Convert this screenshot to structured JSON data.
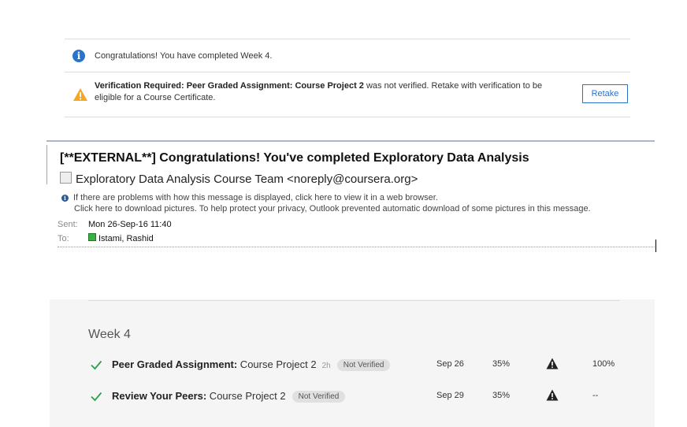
{
  "notices": {
    "completed": "Congratulations! You have completed Week 4.",
    "verification_bold": "Verification Required: Peer Graded Assignment: Course Project 2",
    "verification_rest": " was not verified. Retake with verification to be eligible for a Course Certificate.",
    "retake_label": "Retake"
  },
  "email": {
    "subject": "[**EXTERNAL**] Congratulations! You've completed Exploratory Data Analysis",
    "sender": "Exploratory Data Analysis Course Team <noreply@coursera.org>",
    "info_line1": "If there are problems with how this message is displayed, click here to view it in a web browser.",
    "info_line2": "Click here to download pictures. To help protect your privacy, Outlook prevented automatic download of some pictures in this message.",
    "sent_label": "Sent:",
    "sent_value": "Mon 26-Sep-16 11:40",
    "to_label": "To:",
    "to_value": "Istami, Rashid"
  },
  "grades": {
    "week_title": "Week 4",
    "rows": [
      {
        "type": "Peer Graded Assignment:",
        "name": " Course Project 2",
        "duration": "2h",
        "status": "Not Verified",
        "due": "Sep 26",
        "weight": "35%",
        "grade": "100%"
      },
      {
        "type": "Review Your Peers:",
        "name": " Course Project 2",
        "duration": "",
        "status": "Not Verified",
        "due": "Sep 29",
        "weight": "35%",
        "grade": "--"
      }
    ]
  },
  "colors": {
    "accent": "#2a73cc",
    "warning": "#f5a623",
    "check": "#2e9e4f"
  },
  "icons": {
    "info": "info-icon",
    "warning": "warning-icon",
    "check": "checkmark-icon",
    "alert": "alert-triangle-icon"
  }
}
